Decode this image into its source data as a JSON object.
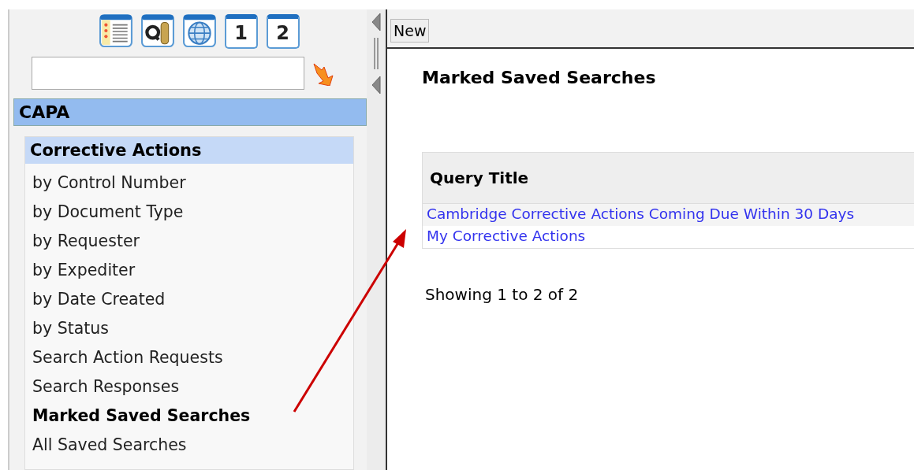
{
  "sidebar": {
    "toolbar_icons": [
      "1",
      "2"
    ],
    "module": "CAPA",
    "section": {
      "title": "Corrective Actions",
      "items": [
        {
          "label": "by Control Number",
          "selected": false
        },
        {
          "label": "by Document Type",
          "selected": false
        },
        {
          "label": "by Requester",
          "selected": false
        },
        {
          "label": "by Expediter",
          "selected": false
        },
        {
          "label": "by Date Created",
          "selected": false
        },
        {
          "label": "by Status",
          "selected": false
        },
        {
          "label": "Search Action Requests",
          "selected": false
        },
        {
          "label": "Search Responses",
          "selected": false
        },
        {
          "label": "Marked Saved Searches",
          "selected": true
        },
        {
          "label": "All Saved Searches",
          "selected": false
        }
      ]
    }
  },
  "toolbar": {
    "buttons": [
      "New"
    ]
  },
  "main": {
    "title": "Marked Saved Searches",
    "table": {
      "columns": [
        "Query Title"
      ],
      "rows": [
        {
          "title": "Cambridge Corrective Actions Coming Due Within 30 Days"
        },
        {
          "title": "My Corrective Actions"
        }
      ]
    },
    "footer": "Showing 1 to 2 of 2"
  }
}
